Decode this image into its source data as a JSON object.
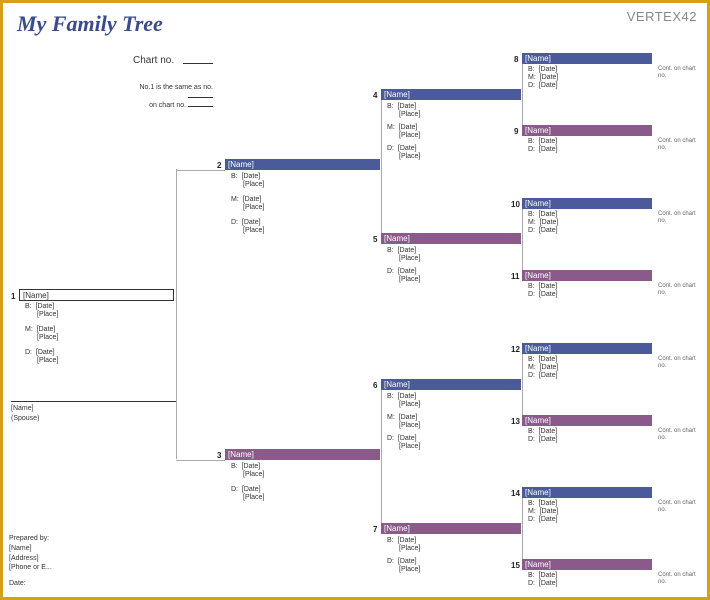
{
  "title": "My Family Tree",
  "logo": "VERTEX42",
  "chart_no_label": "Chart no.",
  "note_same": "No.1 is the same as no.",
  "note_chart": "on chart no.",
  "labels": {
    "name": "[Name]",
    "date": "[Date]",
    "place": "[Place]",
    "b": "B:",
    "m": "M:",
    "d": "D:",
    "spouse": "(Spouse)",
    "cont": "Cont. on chart no."
  },
  "prepared": {
    "header": "Prepared by:",
    "name": "[Name]",
    "address": "[Address]",
    "phone": "[Phone or E...",
    "date": "Date:"
  },
  "nodes": {
    "n1": "1",
    "n2": "2",
    "n3": "3",
    "n4": "4",
    "n5": "5",
    "n6": "6",
    "n7": "7",
    "n8": "8",
    "n9": "9",
    "n10": "10",
    "n11": "11",
    "n12": "12",
    "n13": "13",
    "n14": "14",
    "n15": "15"
  }
}
